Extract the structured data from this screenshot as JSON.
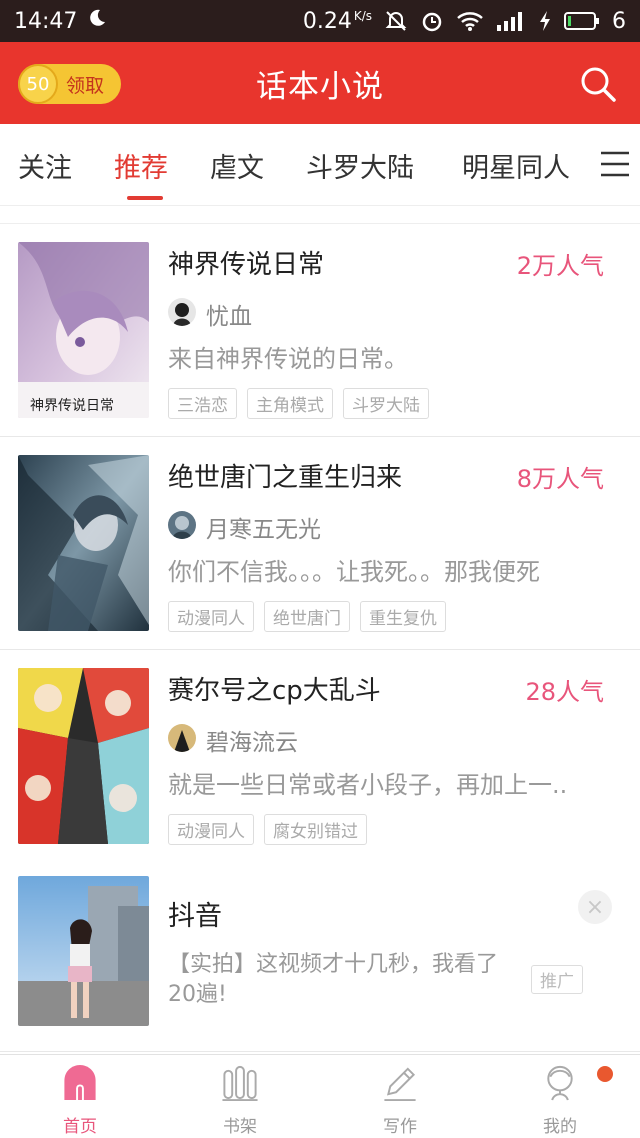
{
  "status_bar": {
    "time": "14:47",
    "net_speed": "0.24",
    "net_unit": "K/s",
    "battery_level": "6",
    "icons": [
      "moon-icon",
      "mute-icon",
      "alarm-icon",
      "wifi-icon",
      "signal-icon",
      "charging-icon",
      "battery-icon"
    ]
  },
  "header": {
    "coins": "50",
    "claim_label": "领取",
    "title": "话本小说",
    "accent_color": "#e8352d"
  },
  "tabs": [
    {
      "label": "关注",
      "active": false
    },
    {
      "label": "推荐",
      "active": true
    },
    {
      "label": "虐文",
      "active": false
    },
    {
      "label": "斗罗大陆",
      "active": false
    },
    {
      "label": "明星同人",
      "active": false
    }
  ],
  "cards": [
    {
      "title": "神界传说日常",
      "popularity": "2万人气",
      "author": "忧血",
      "description": "来自神界传说的日常。",
      "tags": [
        "三浩恋",
        "主角模式",
        "斗罗大陆"
      ]
    },
    {
      "title": "绝世唐门之重生归来",
      "popularity": "8万人气",
      "author": "月寒五无光",
      "description": "你们不信我。。。让我死。。那我便死",
      "tags": [
        "动漫同人",
        "绝世唐门",
        "重生复仇"
      ]
    },
    {
      "title": "赛尔号之cp大乱斗",
      "popularity": "28人气",
      "author": "碧海流云",
      "description": "就是一些日常或者小段子，再加上一..",
      "tags": [
        "动漫同人",
        "腐女别错过"
      ]
    }
  ],
  "ad": {
    "title": "抖音",
    "description": "【实拍】这视频才十几秒，我看了20遍!",
    "badge": "推广"
  },
  "bottom_nav": [
    {
      "label": "首页",
      "icon": "home-icon",
      "active": true
    },
    {
      "label": "书架",
      "icon": "bookshelf-icon",
      "active": false
    },
    {
      "label": "写作",
      "icon": "pen-icon",
      "active": false
    },
    {
      "label": "我的",
      "icon": "profile-icon",
      "active": false
    }
  ]
}
